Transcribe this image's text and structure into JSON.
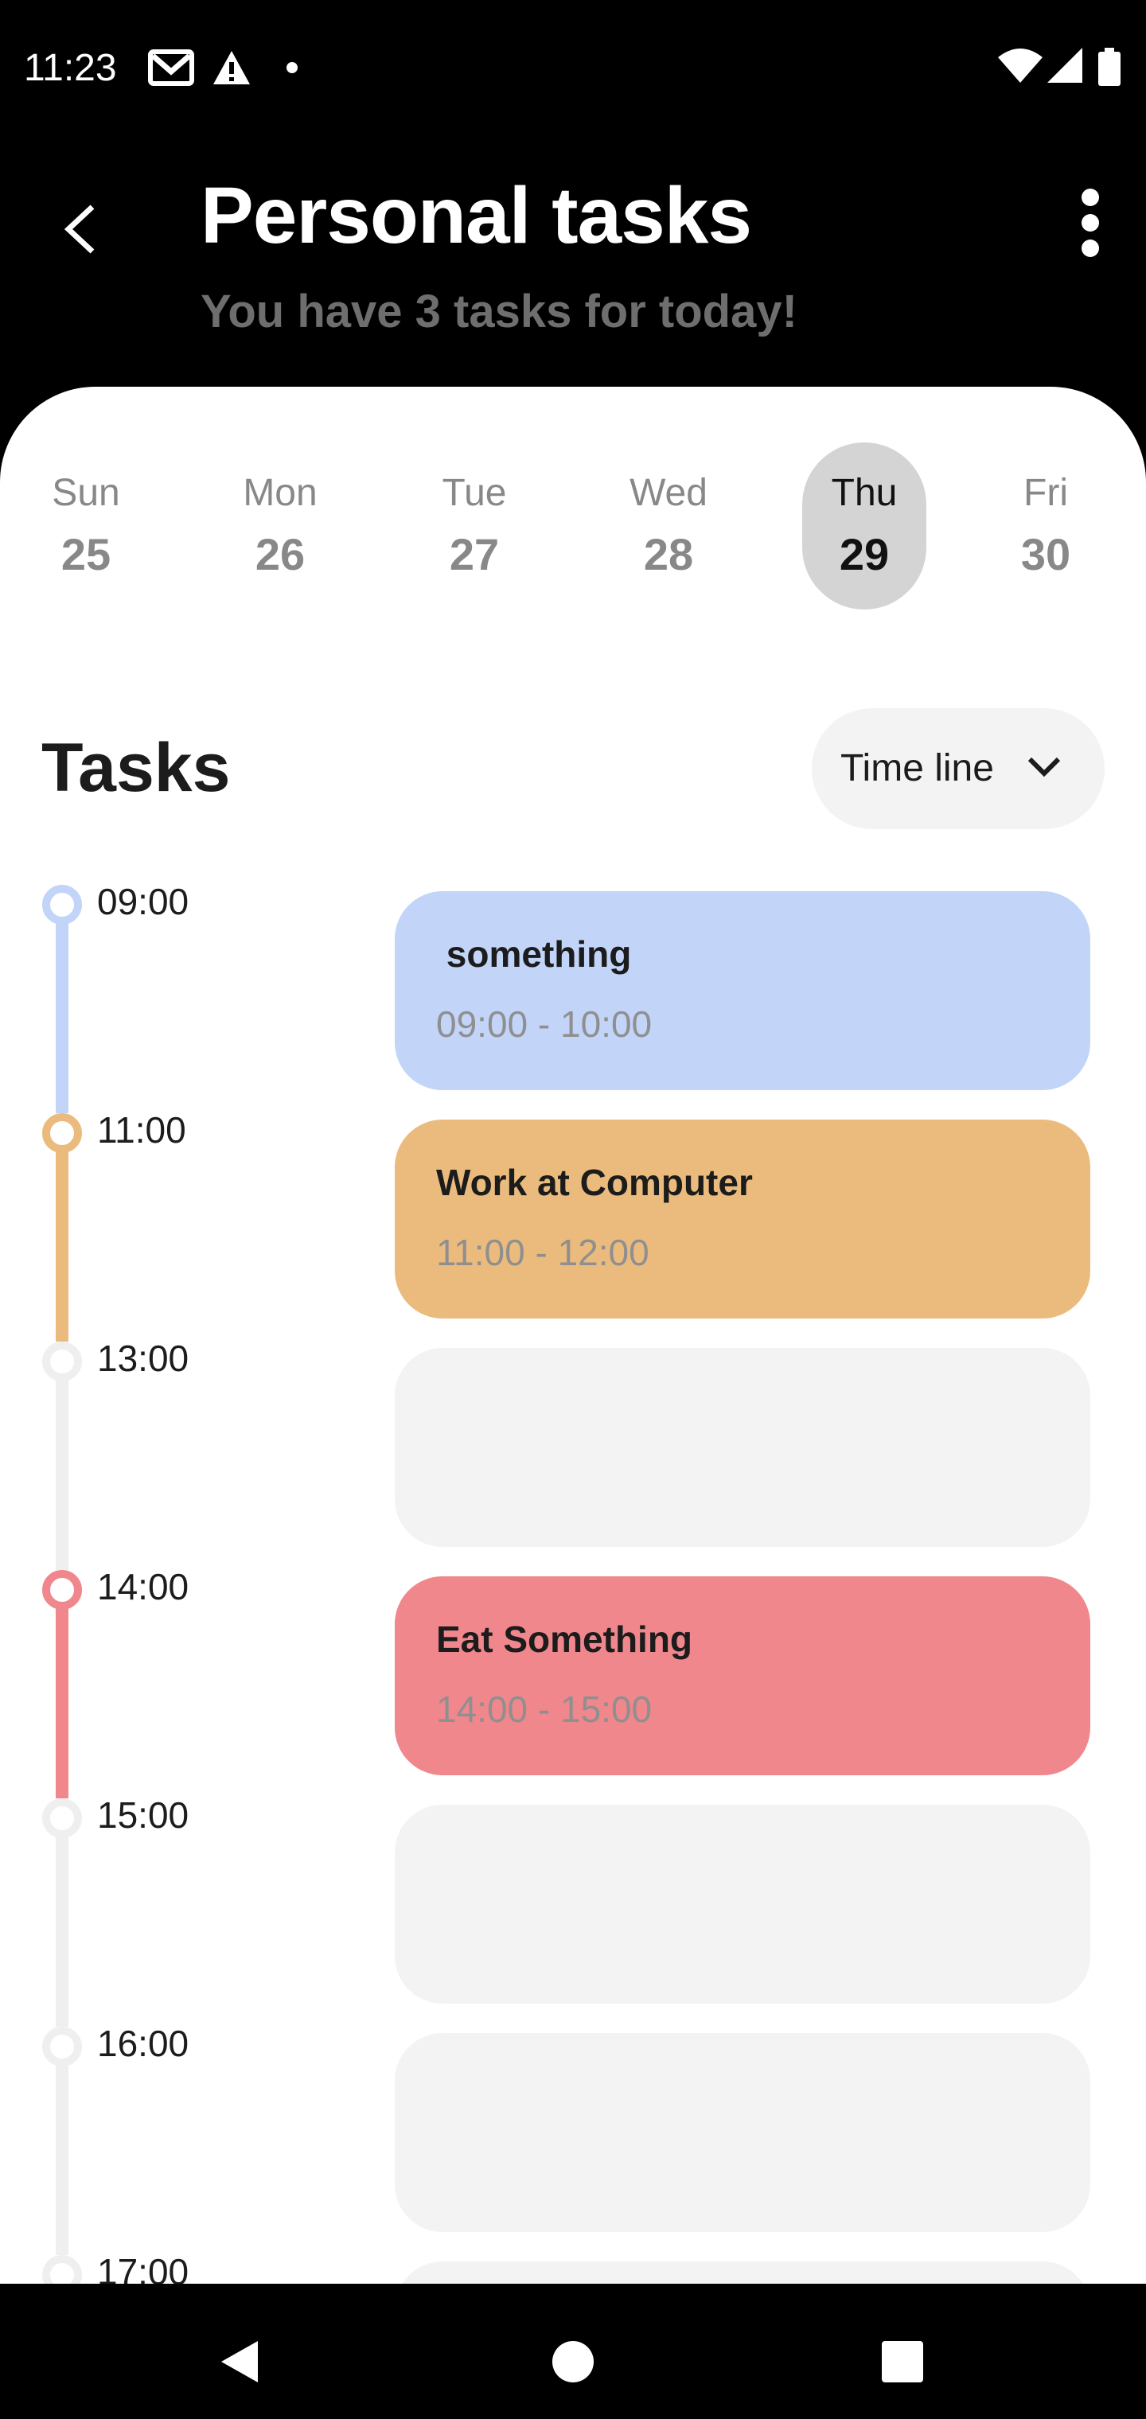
{
  "status_bar": {
    "time": "11:23",
    "left_icons": [
      "gmail-icon",
      "alert-icon",
      "dot-icon"
    ],
    "right_icons": [
      "wifi-icon",
      "signal-icon",
      "battery-icon"
    ]
  },
  "header": {
    "title": "Personal tasks",
    "subtitle": "You have 3 tasks for today!",
    "back_icon": "back-arrow-icon",
    "menu_icon": "more-vertical-icon"
  },
  "days": [
    {
      "name": "Sun",
      "num": "25",
      "selected": false
    },
    {
      "name": "Mon",
      "num": "26",
      "selected": false
    },
    {
      "name": "Tue",
      "num": "27",
      "selected": false
    },
    {
      "name": "Wed",
      "num": "28",
      "selected": false
    },
    {
      "name": "Thu",
      "num": "29",
      "selected": true
    },
    {
      "name": "Fri",
      "num": "30",
      "selected": false
    }
  ],
  "tasks_section": {
    "heading": "Tasks",
    "view_select": "Time line"
  },
  "timeline": [
    {
      "time": "09:00",
      "title": " something",
      "range": "09:00 - 10:00",
      "color": "#c2d4f8",
      "dot_color": "#c2d4f8"
    },
    {
      "time": "11:00",
      "title": "Work at Computer",
      "range": "11:00 - 12:00",
      "color": "#ebbb7e",
      "dot_color": "#ebbb7e"
    },
    {
      "time": "13:00",
      "title": "",
      "range": "",
      "color": "#f3f3f3",
      "dot_color": "#efefef"
    },
    {
      "time": "14:00",
      "title": "Eat Something",
      "range": "14:00 - 15:00",
      "color": "#f0878c",
      "dot_color": "#f0878c"
    },
    {
      "time": "15:00",
      "title": "",
      "range": "",
      "color": "#f3f3f3",
      "dot_color": "#efefef"
    },
    {
      "time": "16:00",
      "title": "",
      "range": "",
      "color": "#f3f3f3",
      "dot_color": "#efefef"
    },
    {
      "time": "17:00",
      "title": "",
      "range": "",
      "color": "#f3f3f3",
      "dot_color": "#efefef"
    }
  ],
  "nav_bar": {
    "icons": [
      "nav-back-icon",
      "nav-home-icon",
      "nav-recents-icon"
    ]
  }
}
